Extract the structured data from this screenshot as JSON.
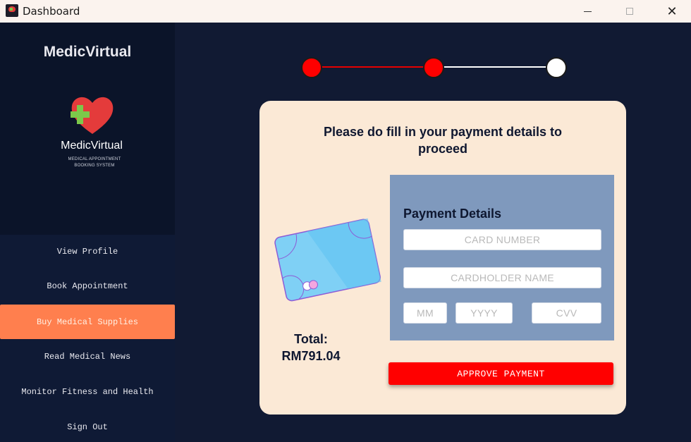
{
  "window": {
    "title": "Dashboard",
    "controls": {
      "minimize_icon": "minimize-icon",
      "maximize_icon": "maximize-icon",
      "close_label": "✕"
    }
  },
  "sidebar": {
    "brand_title": "MedicVirtual",
    "logo": {
      "name": "MedicVirtual",
      "subtitle_line1": "MEDICAL APPOINTMENT",
      "subtitle_line2": "BOOKING SYSTEM",
      "heart_color": "#e43b3b",
      "cross_color": "#7cc94a"
    },
    "items": [
      {
        "label": "View Profile",
        "active": false
      },
      {
        "label": "Book Appointment",
        "active": false
      },
      {
        "label": "Buy Medical Supplies",
        "active": true
      },
      {
        "label": "Read Medical News",
        "active": false
      },
      {
        "label": "Monitor Fitness and Health",
        "active": false
      },
      {
        "label": "Sign Out",
        "active": false
      }
    ],
    "active_color": "#ff7f4e"
  },
  "stepper": {
    "total_steps": 3,
    "completed_steps": 2,
    "completed_color": "#ff0000",
    "pending_color": "#ffffff"
  },
  "payment": {
    "heading": "Please do fill in your payment details to proceed",
    "total_label": "Total:",
    "total_value": "RM791.04",
    "details_title": "Payment Details",
    "fields": {
      "card_number": {
        "placeholder": "CARD NUMBER",
        "value": ""
      },
      "cardholder_name": {
        "placeholder": "CARDHOLDER NAME",
        "value": ""
      },
      "month": {
        "placeholder": "MM",
        "value": ""
      },
      "year": {
        "placeholder": "YYYY",
        "value": ""
      },
      "cvv": {
        "placeholder": "CVV",
        "value": ""
      }
    },
    "approve_label": "APPROVE PAYMENT",
    "panel_color": "#fbe9d6",
    "details_color": "#7f99bd",
    "approve_color": "#ff0000"
  }
}
